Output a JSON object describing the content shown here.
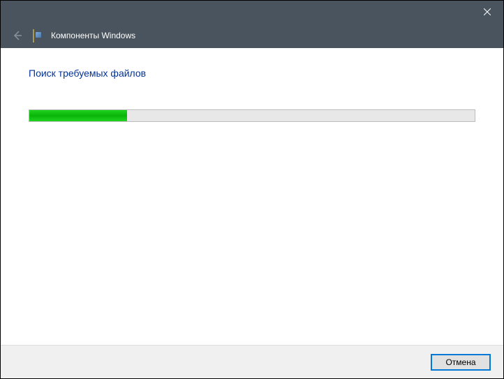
{
  "titlebar": {
    "close_icon": "close"
  },
  "header": {
    "back_icon": "back-arrow",
    "app_icon": "windows-features-icon",
    "title": "Компоненты Windows"
  },
  "content": {
    "heading": "Поиск требуемых файлов",
    "progress_percent": 22
  },
  "footer": {
    "cancel_label": "Отмена"
  }
}
